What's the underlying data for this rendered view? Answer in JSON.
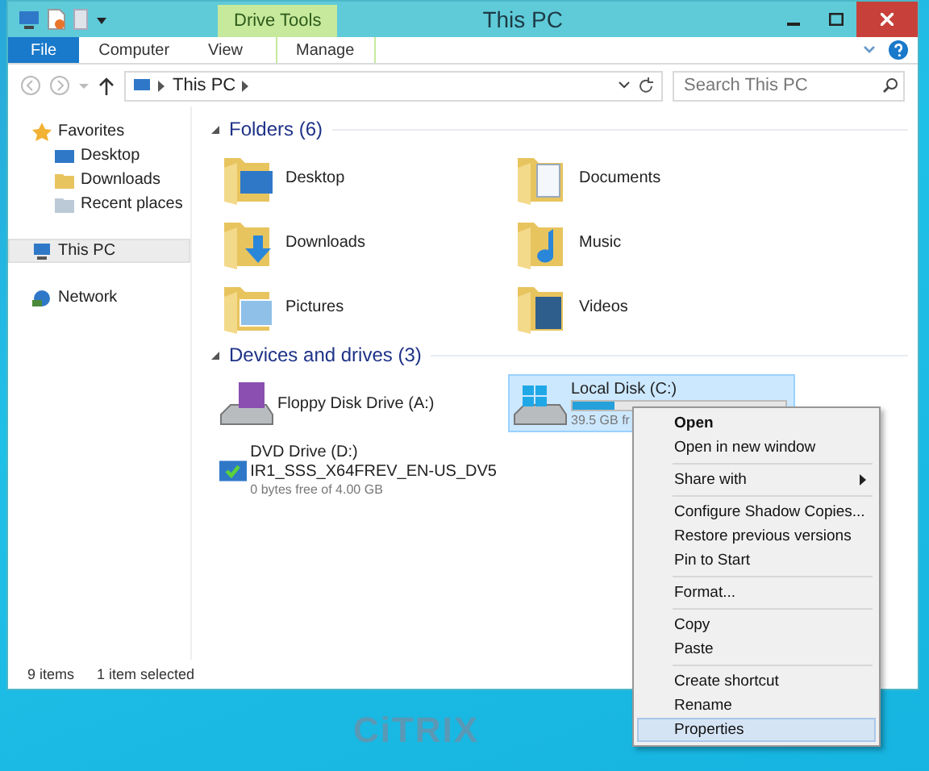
{
  "window": {
    "title": "This PC",
    "contextual_group": "Drive Tools"
  },
  "ribbon": {
    "tabs": [
      {
        "label": "File",
        "kind": "file"
      },
      {
        "label": "Computer",
        "kind": "normal"
      },
      {
        "label": "View",
        "kind": "normal"
      },
      {
        "label": "Manage",
        "kind": "contextual"
      }
    ]
  },
  "address_bar": {
    "path": [
      "This PC"
    ]
  },
  "search": {
    "placeholder": "Search This PC"
  },
  "navigation": [
    {
      "label": "Favorites",
      "kind": "favorites",
      "selected": false,
      "children": [
        {
          "label": "Desktop",
          "kind": "desktop",
          "selected": false
        },
        {
          "label": "Downloads",
          "kind": "downloads",
          "selected": false
        },
        {
          "label": "Recent places",
          "kind": "recent",
          "selected": false
        }
      ]
    },
    {
      "label": "This PC",
      "kind": "pc",
      "selected": true
    },
    {
      "label": "Network",
      "kind": "network",
      "selected": false
    }
  ],
  "folders": {
    "title": "Folders (6)",
    "items": [
      {
        "name": "Desktop",
        "kind": "desktop"
      },
      {
        "name": "Documents",
        "kind": "documents"
      },
      {
        "name": "Downloads",
        "kind": "downloads"
      },
      {
        "name": "Music",
        "kind": "music"
      },
      {
        "name": "Pictures",
        "kind": "pictures"
      },
      {
        "name": "Videos",
        "kind": "videos"
      }
    ]
  },
  "drives": {
    "title": "Devices and drives (3)",
    "items": [
      {
        "name": "Floppy Disk Drive (A:)",
        "kind": "floppy",
        "selected": false
      },
      {
        "name": "Local Disk (C:)",
        "kind": "disk",
        "selected": true,
        "level": 0.2,
        "free": "39.5 GB fr"
      },
      {
        "name": "DVD Drive (D:)",
        "kind": "dvd",
        "selected": false,
        "label": "IR1_SSS_X64FREV_EN-US_DV5",
        "free": "0 bytes free of 4.00 GB"
      }
    ]
  },
  "status_bar": {
    "count": "9 items",
    "selection": "1 item selected"
  },
  "context_menu": [
    [
      {
        "label": "Open",
        "default": true,
        "submenu": false,
        "selected": false
      },
      {
        "label": "Open in new window",
        "default": false,
        "submenu": false,
        "selected": false
      }
    ],
    [
      {
        "label": "Share with",
        "default": false,
        "submenu": true,
        "selected": false
      }
    ],
    [
      {
        "label": "Configure Shadow Copies...",
        "default": false,
        "submenu": false,
        "selected": false
      },
      {
        "label": "Restore previous versions",
        "default": false,
        "submenu": false,
        "selected": false
      },
      {
        "label": "Pin to Start",
        "default": false,
        "submenu": false,
        "selected": false
      }
    ],
    [
      {
        "label": "Format...",
        "default": false,
        "submenu": false,
        "selected": false
      }
    ],
    [
      {
        "label": "Copy",
        "default": false,
        "submenu": false,
        "selected": false
      },
      {
        "label": "Paste",
        "default": false,
        "submenu": false,
        "selected": false
      }
    ],
    [
      {
        "label": "Create shortcut",
        "default": false,
        "submenu": false,
        "selected": false
      },
      {
        "label": "Rename",
        "default": false,
        "submenu": false,
        "selected": false
      },
      {
        "label": "Properties",
        "default": false,
        "submenu": false,
        "selected": true
      }
    ]
  ],
  "desktop": {
    "logo": "CiTRIX"
  }
}
